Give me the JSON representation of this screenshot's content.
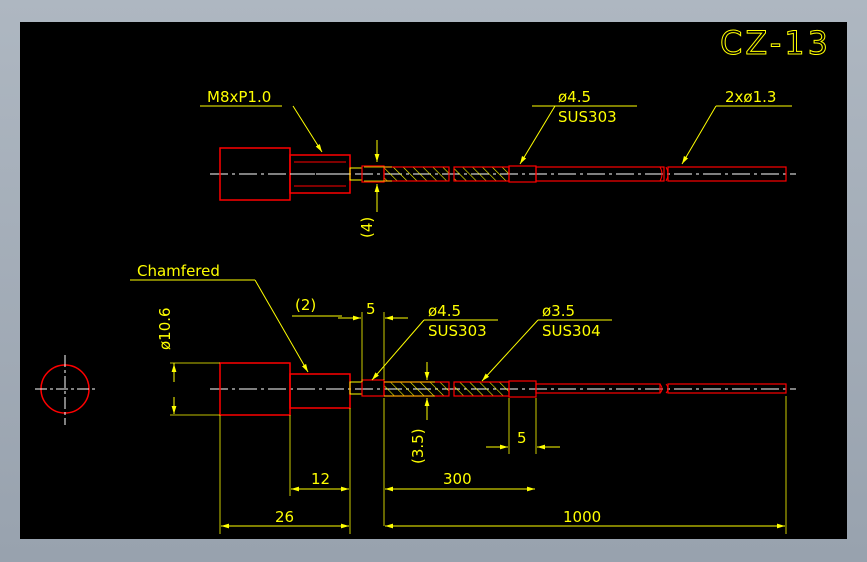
{
  "drawing": {
    "title": "CZ-13",
    "top_view": {
      "thread_label": "M8xP1.0",
      "tube_dia_label": "ø4.5",
      "tube_material_label": "SUS303",
      "holes_label": "2xø1.3",
      "gap_label": "(4)"
    },
    "bottom_view": {
      "chamfer_label": "Chamfered",
      "chamfer_size_label": "(2)",
      "head_dia_label": "ø10.6",
      "step_label": "5",
      "tube_dia_label": "ø4.5",
      "tube_material_label": "SUS303",
      "tip_dia_label": "ø3.5",
      "tip_material_label": "SUS304",
      "gap_label": "(3.5)",
      "tip_step_label": "5",
      "dim_12": "12",
      "dim_300": "300",
      "dim_26": "26",
      "dim_1000": "1000"
    }
  },
  "colors": {
    "background": "#000000",
    "dimension": "#ffff00",
    "outline": "#ff0000",
    "centerline": "#ffffff",
    "frame": "#a4adb8"
  }
}
